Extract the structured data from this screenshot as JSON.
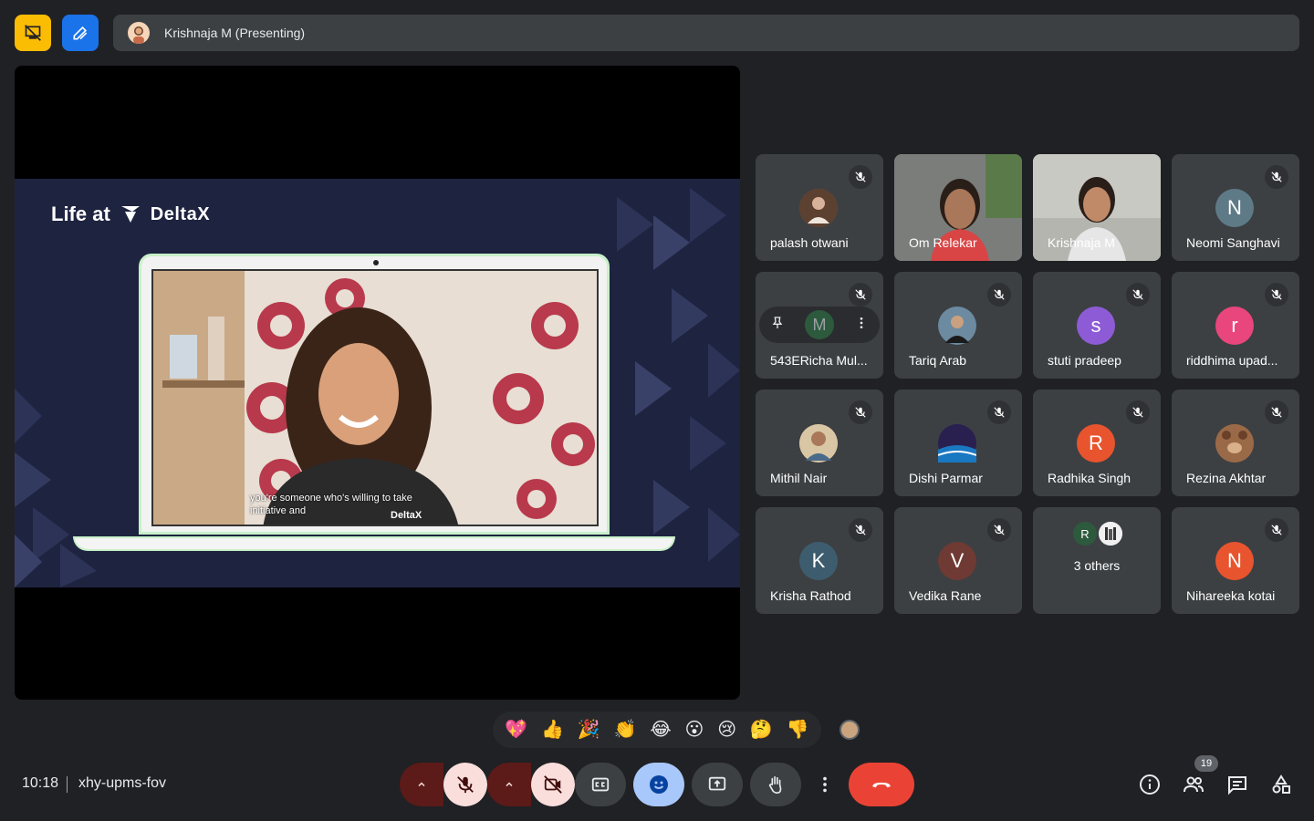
{
  "header": {
    "presenter_label": "Krishnaja M (Presenting)"
  },
  "slide": {
    "heading_prefix": "Life at",
    "brand": "DeltaX",
    "caption_line1": "you're someone who's willing to take",
    "caption_line2": "initiative and",
    "caption_brand": "DeltaX"
  },
  "participants": [
    {
      "name": "palash otwani",
      "initial": "",
      "color": "#7a5a48",
      "muted": true,
      "video": false
    },
    {
      "name": "Om Relekar",
      "initial": "",
      "color": "#6d6d6d",
      "muted": false,
      "video": true
    },
    {
      "name": "Krishnaja M",
      "initial": "",
      "color": "#9a9a98",
      "muted": false,
      "video": true
    },
    {
      "name": "Neomi Sanghavi",
      "initial": "N",
      "color": "#5f7a87",
      "muted": true,
      "video": false
    },
    {
      "name": "543ERicha Mul...",
      "initial": "M",
      "color": "#2d5a3d",
      "muted": true,
      "video": false
    },
    {
      "name": "Tariq Arab",
      "initial": "",
      "color": "#3a3a3a",
      "muted": true,
      "video": false
    },
    {
      "name": "stuti pradeep",
      "initial": "s",
      "color": "#8e5bd6",
      "muted": true,
      "video": false
    },
    {
      "name": "riddhima upad...",
      "initial": "r",
      "color": "#e8467c",
      "muted": true,
      "video": false
    },
    {
      "name": "Mithil Nair",
      "initial": "",
      "color": "#b89c7a",
      "muted": true,
      "video": false
    },
    {
      "name": "Dishi Parmar",
      "initial": "",
      "color": "#1d3b5e",
      "muted": true,
      "video": false
    },
    {
      "name": "Radhika Singh",
      "initial": "R",
      "color": "#e8542e",
      "muted": true,
      "video": false
    },
    {
      "name": "Rezina Akhtar",
      "initial": "",
      "color": "#8a5a3c",
      "muted": true,
      "video": false
    },
    {
      "name": "Krisha Rathod",
      "initial": "K",
      "color": "#3d5d6e",
      "muted": true,
      "video": false
    },
    {
      "name": "Vedika Rane",
      "initial": "V",
      "color": "#6e3a33",
      "muted": true,
      "video": false
    },
    {
      "name": "3 others",
      "initial": "",
      "color": "#3c4043",
      "muted": false,
      "video": false
    },
    {
      "name": "Nihareeka kotai",
      "initial": "N",
      "color": "#e8542e",
      "muted": true,
      "video": false
    }
  ],
  "others": {
    "avatar1": "R",
    "label": "3 others"
  },
  "reactions": [
    "💖",
    "👍",
    "🎉",
    "👏",
    "😂",
    "😮",
    "😢",
    "🤔",
    "👎"
  ],
  "footer": {
    "time": "10:18",
    "meeting_code": "xhy-upms-fov",
    "people_count": "19"
  },
  "colors": {
    "background": "#202124",
    "tile": "#3c4043",
    "end_call": "#ea4335",
    "mute_active": "#f9dedc",
    "reactions_active": "#a8c7fa"
  }
}
